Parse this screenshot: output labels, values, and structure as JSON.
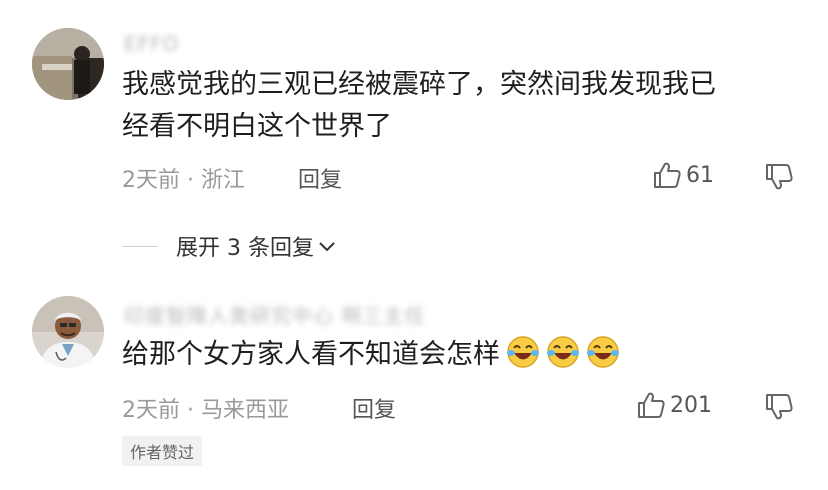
{
  "comments": [
    {
      "username": "EFFO",
      "content_line1": "我感觉我的三观已经被震碎了，突然间我发现我已",
      "content_line2": "经看不明白这个世界了",
      "time": "2天前",
      "separator": "·",
      "location": "浙江",
      "reply_label": "回复",
      "likes": "61",
      "expand_label": "展开 3 条回复"
    },
    {
      "username": "印度智障人类研究中心 啊三主任",
      "content": "给那个女方家人看不知道会怎样",
      "emojis": [
        "laughing-tears-icon",
        "laughing-tears-icon",
        "laughing-tears-icon"
      ],
      "time": "2天前",
      "separator": "·",
      "location": "马来西亚",
      "reply_label": "回复",
      "likes": "201",
      "badge": "作者赞过"
    }
  ],
  "colors": {
    "meta": "#9a9a9a",
    "text": "#1f1f1f",
    "badge_bg": "#f1f1f1"
  }
}
